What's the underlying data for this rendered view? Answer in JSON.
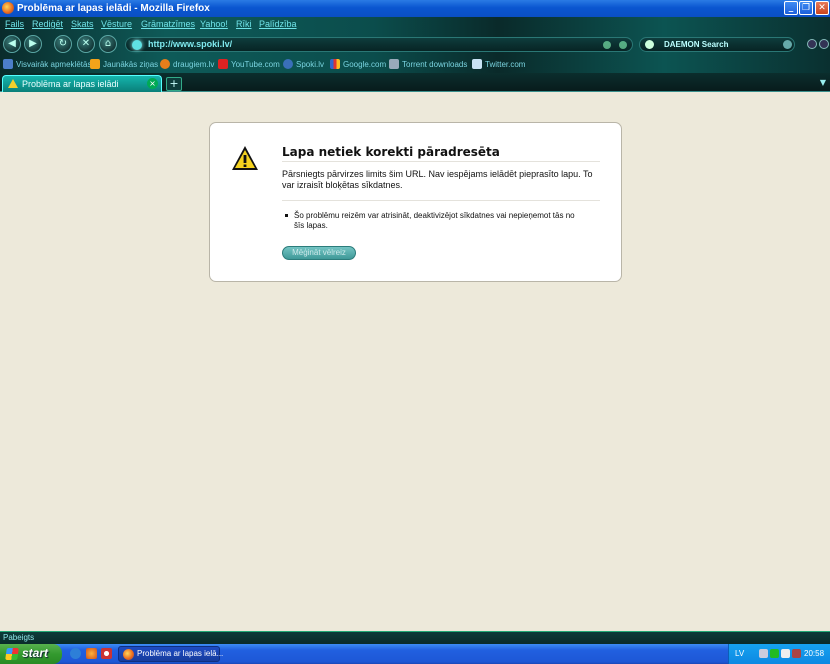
{
  "window": {
    "title": "Problēma ar lapas ielādi - Mozilla Firefox"
  },
  "menu": [
    "Fails",
    "Rediģēt",
    "Skats",
    "Vēsture",
    "Grāmatzīmes",
    "Yahoo!",
    "Rīki",
    "Palīdzība"
  ],
  "address": {
    "url": "http://www.spoki.lv/"
  },
  "search": {
    "engine": "DAEMON Search"
  },
  "bookmarks": [
    {
      "label": "Visvairāk apmeklētās"
    },
    {
      "label": "Jaunākās ziņas"
    },
    {
      "label": "draugiem.lv"
    },
    {
      "label": "YouTube.com"
    },
    {
      "label": "Spoki.lv"
    },
    {
      "label": "Google.com"
    },
    {
      "label": "Torrent downloads"
    },
    {
      "label": "Twitter.com"
    }
  ],
  "tab": {
    "label": "Problēma ar lapas ielādi"
  },
  "error": {
    "title": "Lapa netiek korekti pāradresēta",
    "description": "Pārsniegts pārvirzes limits šim URL. Nav iespējams ielādēt pieprasīto lapu. To var izraisīt bloķētas sīkdatnes.",
    "hint": "Šo problēmu reizēm var atrisināt, deaktivizējot sīkdatnes vai nepieņemot tās no šīs lapas.",
    "retry_label": "Mēģināt vēlreiz"
  },
  "status": {
    "text": "Pabeigts"
  },
  "taskbar": {
    "start_label": "start",
    "task_label": "Problēma ar lapas ielā...",
    "language": "LV",
    "clock": "20:58"
  }
}
